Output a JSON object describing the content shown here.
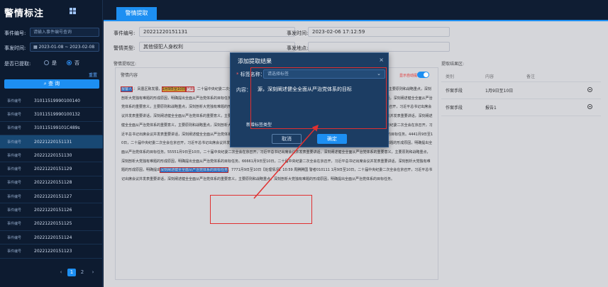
{
  "app": {
    "title": "警情标注"
  },
  "sidebar": {
    "event_no_label": "事件编号:",
    "event_no_placeholder": "请输入事件编号查询",
    "event_time_label": "事发时间:",
    "date_range": "2023-01-08 ~ 2023-02-08",
    "extracted_label": "是否已提取:",
    "radio_yes": "是",
    "radio_no": "否",
    "reset": "重置",
    "query_button": "查 询",
    "rows": [
      {
        "label": "事件编号",
        "value": "31011519990100140"
      },
      {
        "label": "事件编号",
        "value": "31011519990100132"
      },
      {
        "label": "事件编号",
        "value": "310115199101C489s"
      },
      {
        "label": "事件编号",
        "value": "20221220151131"
      },
      {
        "label": "事件编号",
        "value": "20221220151130"
      },
      {
        "label": "事件编号",
        "value": "20221220151129"
      },
      {
        "label": "事件编号",
        "value": "20221220151128"
      },
      {
        "label": "事件编号",
        "value": "20221220151127"
      },
      {
        "label": "事件编号",
        "value": "20221220151126"
      },
      {
        "label": "事件编号",
        "value": "20221220151125"
      },
      {
        "label": "事件编号",
        "value": "20221220151124"
      },
      {
        "label": "事件编号",
        "value": "20221220151123"
      }
    ],
    "pager": {
      "prev": "‹",
      "p1": "1",
      "p2": "2",
      "next": "›"
    }
  },
  "tab": {
    "label": "警情提取"
  },
  "form": {
    "event_no_label": "事件编号:",
    "event_no_value": "20221220151131",
    "time_label": "事发时间:",
    "time_value": "2023-02-06 17:12:59",
    "type_label": "警情类型:",
    "type_value": "其他侵犯人身权利",
    "place_label": "事发地点:",
    "place_value": ""
  },
  "content_area": {
    "section_label": "警情提取区:",
    "title": "警情内容",
    "text_a": "。",
    "tag1": "报警人",
    "text_b": "：凤凰区致发展，",
    "tag2": "1月9日至10日",
    "tag3": "已到",
    "text_c": "。二十届中央纪委二次全会在京召开，习近平总书记出席会议并发表重要讲话，深刻阐述健全全面从严治党体系的重要意义、主要原则和战略重点，深刻剖析大党独有难题的形成原因，明确提出全面从严治党体系的目标任务。111111月9日至10日，二十届中央纪委二次全会在京召开，习近平总书记出席会议并发表重要讲话，深刻阐述健全全面从严治党体系的重要意义，主要原则和战略重点，深刻剖析大党独有难题的形成原因，明确提出全面从严治党体系的目标任务。7777月9日至10日，二十届中央纪委二次全会在京召开，习近平总书记出席会议并发表重要讲话，深刻阐述健全全面从严治党体系的重要意义，主要原则和战略重点。222222月9日至10日，二十届中央纪委二次全会在京召开，习近平总书记出席会议并发表重要讲话，深刻阐述健全全面从严治党体系的重要意义，主要原则和战略重点，深刻剖析大党独有难题的形成原因，明确提出全面从严治党体系的目标任务。333331月9日至10日，二十届中央纪委二次全会在京召开，习近平总书记出席会议并发表重要讲话，深刻阐述健全全面从严治党体系的重要意义，主要原则和战略重点，深刻剖析大党独有难题的形成原因，明确提出全面从严治党体系的目标任务。4441月9日至10日，二十届中央纪委二次全会在京召开，习近平总书记出席会议并发表重要讲话，深刻阐述健全全面从严治党体系的重要意义、主要原则和战略重点，深刻剖析大党独有难题的形成原因，明确提出全面从严治党体系的目标任务。55551月9日至10日，二十届中央纪委二次全会在京召开，习近平总书记出席会议并发表重要讲话，深刻阐述健全全面从严治党体系的重要意义，主要原则和战略重点，深刻剖析大党独有难题的形成原因，明确提出全面从严治党体系的目标任务。66661月9日至10日，二十届中央纪委二次全会在京召开，习近平总书记出席会议并发表重要讲话，深刻剖析大党独有难题的形成原因，明确提出",
    "tag4": "深刻阐述健全全面从严治党体系的目标任务",
    "text_d": "。7771月9日至10日【处理情况】10:59 周腾腾国 警者010111 1月9日至10日，二十届中央纪委二次全会在京召开，习近平总书记出席会议并发表重要讲话，深刻阐述健全全面从严治党体系的重要意义，主要原则和战略重点，深刻剖析大党独有难题的形成原因，明确提出全面从严治党体系的目标任务。"
  },
  "result_table": {
    "section_label": "提取结果区:",
    "headers": {
      "type": "类别",
      "content": "内容",
      "note": "备注"
    },
    "rows": [
      {
        "type": "作案手段",
        "content": "1月9日至10日",
        "note": ""
      },
      {
        "type": "作案手段",
        "content": "报告1",
        "note": ""
      }
    ]
  },
  "modal": {
    "title": "添加提取结果",
    "close": "×",
    "tag_label": "标签名称：",
    "tag_required": "*",
    "tag_placeholder": "请选择标签",
    "content_label": "内容：",
    "content_value": "源，深刻阐述健全全面从严治党体系的目标",
    "auto_extract_label": "显示自动提取",
    "new_type": "新增标签类型",
    "cancel": "取消",
    "ok": "确定"
  },
  "colors": {
    "accent": "#1d8ff2",
    "sidebar_bg": "#0d1b30",
    "highlight_red": "#e03030"
  }
}
